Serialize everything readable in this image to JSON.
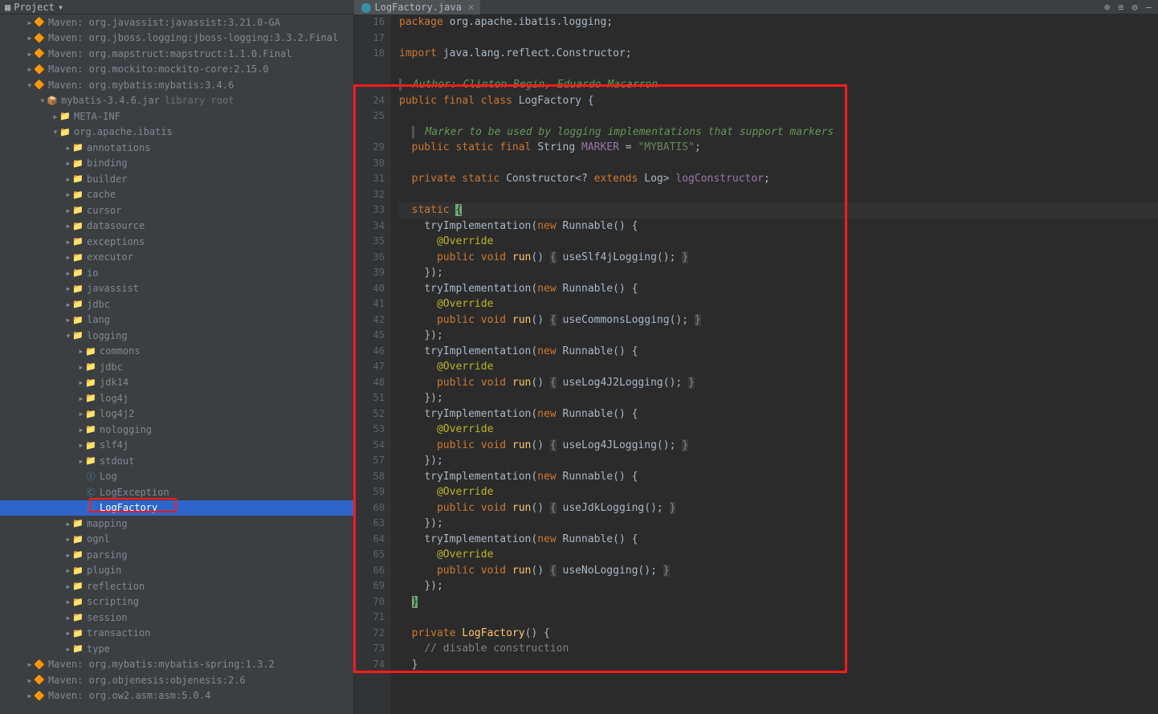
{
  "toolbar": {
    "project_label": "Project"
  },
  "tab": {
    "name": "LogFactory.java"
  },
  "tree": {
    "maven_javassist": "Maven: org.javassist:javassist:3.21.0-GA",
    "maven_jboss": "Maven: org.jboss.logging:jboss-logging:3.3.2.Final",
    "maven_mapstruct": "Maven: org.mapstruct:mapstruct:1.1.0.Final",
    "maven_mockito": "Maven: org.mockito:mockito-core:2.15.0",
    "maven_mybatis": "Maven: org.mybatis:mybatis:3.4.6",
    "jar": "mybatis-3.4.6.jar",
    "libroot": "library root",
    "metainf": "META-INF",
    "pkg": "org.apache.ibatis",
    "annotations": "annotations",
    "binding": "binding",
    "builder": "builder",
    "cache": "cache",
    "cursor": "cursor",
    "datasource": "datasource",
    "exceptions": "exceptions",
    "executor": "executor",
    "io": "io",
    "javassist": "javassist",
    "jdbc_pkg": "jdbc",
    "lang": "lang",
    "logging": "logging",
    "commons": "commons",
    "jdbc": "jdbc",
    "jdk14": "jdk14",
    "log4j": "log4j",
    "log4j2": "log4j2",
    "nologging": "nologging",
    "slf4j": "slf4j",
    "stdout": "stdout",
    "Log": "Log",
    "LogException": "LogException",
    "LogFactory": "LogFactory",
    "mapping": "mapping",
    "ognl": "ognl",
    "parsing": "parsing",
    "plugin": "plugin",
    "reflection": "reflection",
    "scripting": "scripting",
    "session": "session",
    "transaction": "transaction",
    "type": "type",
    "maven_mybatis_spring": "Maven: org.mybatis:mybatis-spring:1.3.2",
    "maven_objenesis": "Maven: org.objenesis:objenesis:2.6",
    "maven_asm": "Maven: org.ow2.asm:asm:5.0.4"
  },
  "code": {
    "lines": [
      {
        "n": 16,
        "html": "<span class='kw'>package</span> <span class='ident'>org.apache.ibatis.logging</span><span class='ident'>;</span>"
      },
      {
        "n": 17,
        "html": ""
      },
      {
        "n": 18,
        "html": "<span class='kw'>import</span> <span class='ident'>java.lang.reflect.Constructor</span><span class='ident'>;</span>"
      },
      {
        "n": "",
        "html": ""
      },
      {
        "n": "",
        "html": "<span class='doc-bar doc'> Author: Clinton Begin, Eduardo Macarron</span>"
      },
      {
        "n": 24,
        "html": "<span class='kw'>public final class</span> <span class='ident'>LogFactory {</span>"
      },
      {
        "n": 25,
        "html": ""
      },
      {
        "n": "",
        "html": "  <span class='doc-bar doc'> Marker to be used by logging implementations that support markers</span>"
      },
      {
        "n": 29,
        "html": "  <span class='kw'>public static final</span> <span class='ident'>String</span> <span class='field'>MARKER</span> <span class='ident'>= </span><span class='str'>\"MYBATIS\"</span><span class='ident'>;</span>"
      },
      {
        "n": 30,
        "html": ""
      },
      {
        "n": 31,
        "html": "  <span class='kw'>private static</span> <span class='ident'>Constructor&lt;?</span> <span class='kw'>extends</span> <span class='ident'>Log&gt;</span> <span class='field'>logConstructor</span><span class='ident'>;</span>"
      },
      {
        "n": 32,
        "html": ""
      },
      {
        "n": 33,
        "html": "  <span class='kw'>static</span> <span class='static-caret'>{</span>",
        "current": true
      },
      {
        "n": 34,
        "html": "    <span class='ident'>tryImplementation(</span><span class='kw'>new</span> <span class='ident'>Runnable() {</span>"
      },
      {
        "n": 35,
        "html": "      <span class='anno'>@Override</span>"
      },
      {
        "n": 36,
        "html": "      <span class='kw'>public void</span> <span class='method'>run</span><span class='ident'>()</span> <span class='graybox'>{</span> <span class='ident'>useSlf4jLogging();</span> <span class='graybox'>}</span>"
      },
      {
        "n": 39,
        "html": "    <span class='ident'>});</span>"
      },
      {
        "n": 40,
        "html": "    <span class='ident'>tryImplementation(</span><span class='kw'>new</span> <span class='ident'>Runnable() {</span>"
      },
      {
        "n": 41,
        "html": "      <span class='anno'>@Override</span>"
      },
      {
        "n": 42,
        "html": "      <span class='kw'>public void</span> <span class='method'>run</span><span class='ident'>()</span> <span class='graybox'>{</span> <span class='ident'>useCommonsLogging();</span> <span class='graybox'>}</span>"
      },
      {
        "n": 45,
        "html": "    <span class='ident'>});</span>"
      },
      {
        "n": 46,
        "html": "    <span class='ident'>tryImplementation(</span><span class='kw'>new</span> <span class='ident'>Runnable() {</span>"
      },
      {
        "n": 47,
        "html": "      <span class='anno'>@Override</span>"
      },
      {
        "n": 48,
        "html": "      <span class='kw'>public void</span> <span class='method'>run</span><span class='ident'>()</span> <span class='graybox'>{</span> <span class='ident'>useLog4J2Logging();</span> <span class='graybox'>}</span>"
      },
      {
        "n": 51,
        "html": "    <span class='ident'>});</span>"
      },
      {
        "n": 52,
        "html": "    <span class='ident'>tryImplementation(</span><span class='kw'>new</span> <span class='ident'>Runnable() {</span>"
      },
      {
        "n": 53,
        "html": "      <span class='anno'>@Override</span>"
      },
      {
        "n": 54,
        "html": "      <span class='kw'>public void</span> <span class='method'>run</span><span class='ident'>()</span> <span class='graybox'>{</span> <span class='ident'>useLog4JLogging();</span> <span class='graybox'>}</span>"
      },
      {
        "n": 57,
        "html": "    <span class='ident'>});</span>"
      },
      {
        "n": 58,
        "html": "    <span class='ident'>tryImplementation(</span><span class='kw'>new</span> <span class='ident'>Runnable() {</span>"
      },
      {
        "n": 59,
        "html": "      <span class='anno'>@Override</span>"
      },
      {
        "n": 60,
        "html": "      <span class='kw'>public void</span> <span class='method'>run</span><span class='ident'>()</span> <span class='graybox'>{</span> <span class='ident'>useJdkLogging();</span> <span class='graybox'>}</span>"
      },
      {
        "n": 63,
        "html": "    <span class='ident'>});</span>"
      },
      {
        "n": 64,
        "html": "    <span class='ident'>tryImplementation(</span><span class='kw'>new</span> <span class='ident'>Runnable() {</span>"
      },
      {
        "n": 65,
        "html": "      <span class='anno'>@Override</span>"
      },
      {
        "n": 66,
        "html": "      <span class='kw'>public void</span> <span class='method'>run</span><span class='ident'>()</span> <span class='graybox'>{</span> <span class='ident'>useNoLogging();</span> <span class='graybox'>}</span>"
      },
      {
        "n": 69,
        "html": "    <span class='ident'>});</span>"
      },
      {
        "n": 70,
        "html": "  <span class='static-caret'>}</span>"
      },
      {
        "n": 71,
        "html": ""
      },
      {
        "n": 72,
        "html": "  <span class='kw'>private</span> <span class='method'>LogFactory</span><span class='ident'>() {</span>"
      },
      {
        "n": 73,
        "html": "    <span class='comment'>// disable construction</span>"
      },
      {
        "n": 74,
        "html": "  <span class='ident'>}</span>"
      }
    ]
  }
}
